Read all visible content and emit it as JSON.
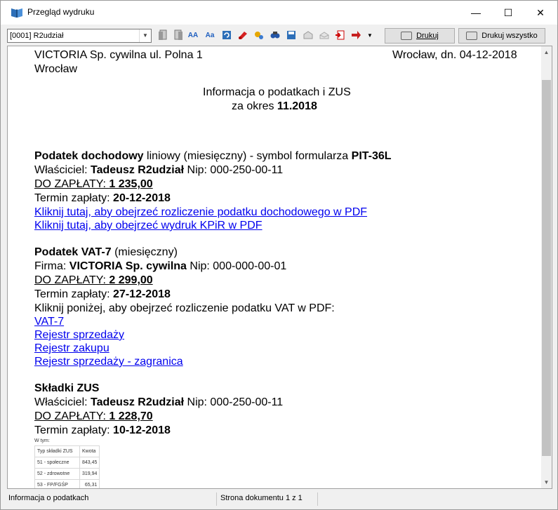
{
  "window": {
    "title": "Przegląd wydruku",
    "minimize_glyph": "—",
    "maximize_glyph": "☐",
    "close_glyph": "✕"
  },
  "toolbar": {
    "document_select_value": "[0001] R2udział",
    "print_label": "Drukuj",
    "print_all_label": "Drukuj wszystko",
    "icons": [
      "page-prev-icon",
      "page-next-icon",
      "font-larger-icon",
      "font-smaller-icon",
      "refresh-icon",
      "pdf-icon",
      "settings-icon",
      "find-icon",
      "save-icon",
      "mail-icon",
      "mail-open-icon",
      "export-icon",
      "forward-icon"
    ],
    "font_larger_glyph": "AA",
    "font_smaller_glyph": "Aa"
  },
  "document": {
    "header_left_1": "VICTORIA Sp. cywilna ul. Polna 1",
    "header_left_2": "Wrocław",
    "header_right": "Wrocław, dn. 04-12-2018",
    "title_line1": "Informacja o podatkach i ZUS",
    "title_period_prefix": "za okres ",
    "title_period": "11.2018",
    "income": {
      "name": "Podatek dochodowy",
      "desc": " liniowy (miesięczny) - symbol formularza ",
      "symbol": "PIT-36L",
      "owner_label": "Właściciel: ",
      "owner_name": "Tadeusz R2udział",
      "owner_nip": " Nip: 000-250-00-11",
      "due_label": "DO ZAPŁATY: ",
      "due_amount": "1 235,00",
      "deadline_label": "Termin zapłaty: ",
      "deadline": "20-12-2018",
      "link1": "Kliknij tutaj, aby obejrzeć rozliczenie podatku dochodowego w PDF",
      "link2": "Kliknij tutaj, aby obejrzeć wydruk KPiR w PDF"
    },
    "vat": {
      "name": "Podatek VAT-7",
      "desc": " (miesięczny)",
      "firm_label": "Firma: ",
      "firm_name": "VICTORIA Sp. cywilna",
      "firm_nip": " Nip: 000-000-00-01",
      "due_label": "DO ZAPŁATY: ",
      "due_amount": "2 299,00",
      "deadline_label": "Termin zapłaty: ",
      "deadline": "27-12-2018",
      "intro": "Kliknij poniżej, aby obejrzeć rozliczenie podatku VAT w PDF:",
      "links": [
        "VAT-7",
        "Rejestr sprzedaży",
        "Rejestr zakupu",
        "Rejestr sprzedaży - zagranica"
      ]
    },
    "zus": {
      "name": "Składki ZUS",
      "owner_label": "Właściciel: ",
      "owner_name": "Tadeusz R2udział",
      "owner_nip": " Nip: 000-250-00-11",
      "due_label": "DO ZAPŁATY: ",
      "due_amount": "1 228,70",
      "deadline_label": "Termin zapłaty: ",
      "deadline": "10-12-2018",
      "breakdown_label": "W tym:",
      "table_headers": [
        "Typ składki ZUS",
        "Kwota"
      ],
      "table_rows": [
        [
          "51 - społeczne",
          "843,45"
        ],
        [
          "52 - zdrowotne",
          "319,94"
        ],
        [
          "53 - FP/FGŚP",
          "65,31"
        ]
      ]
    }
  },
  "status": {
    "left": "Informacja o podatkach",
    "page_info": "Strona dokumentu 1 z 1"
  },
  "colors": {
    "link": "#0000ee",
    "toolbar_bg": "#f0f0f0"
  }
}
